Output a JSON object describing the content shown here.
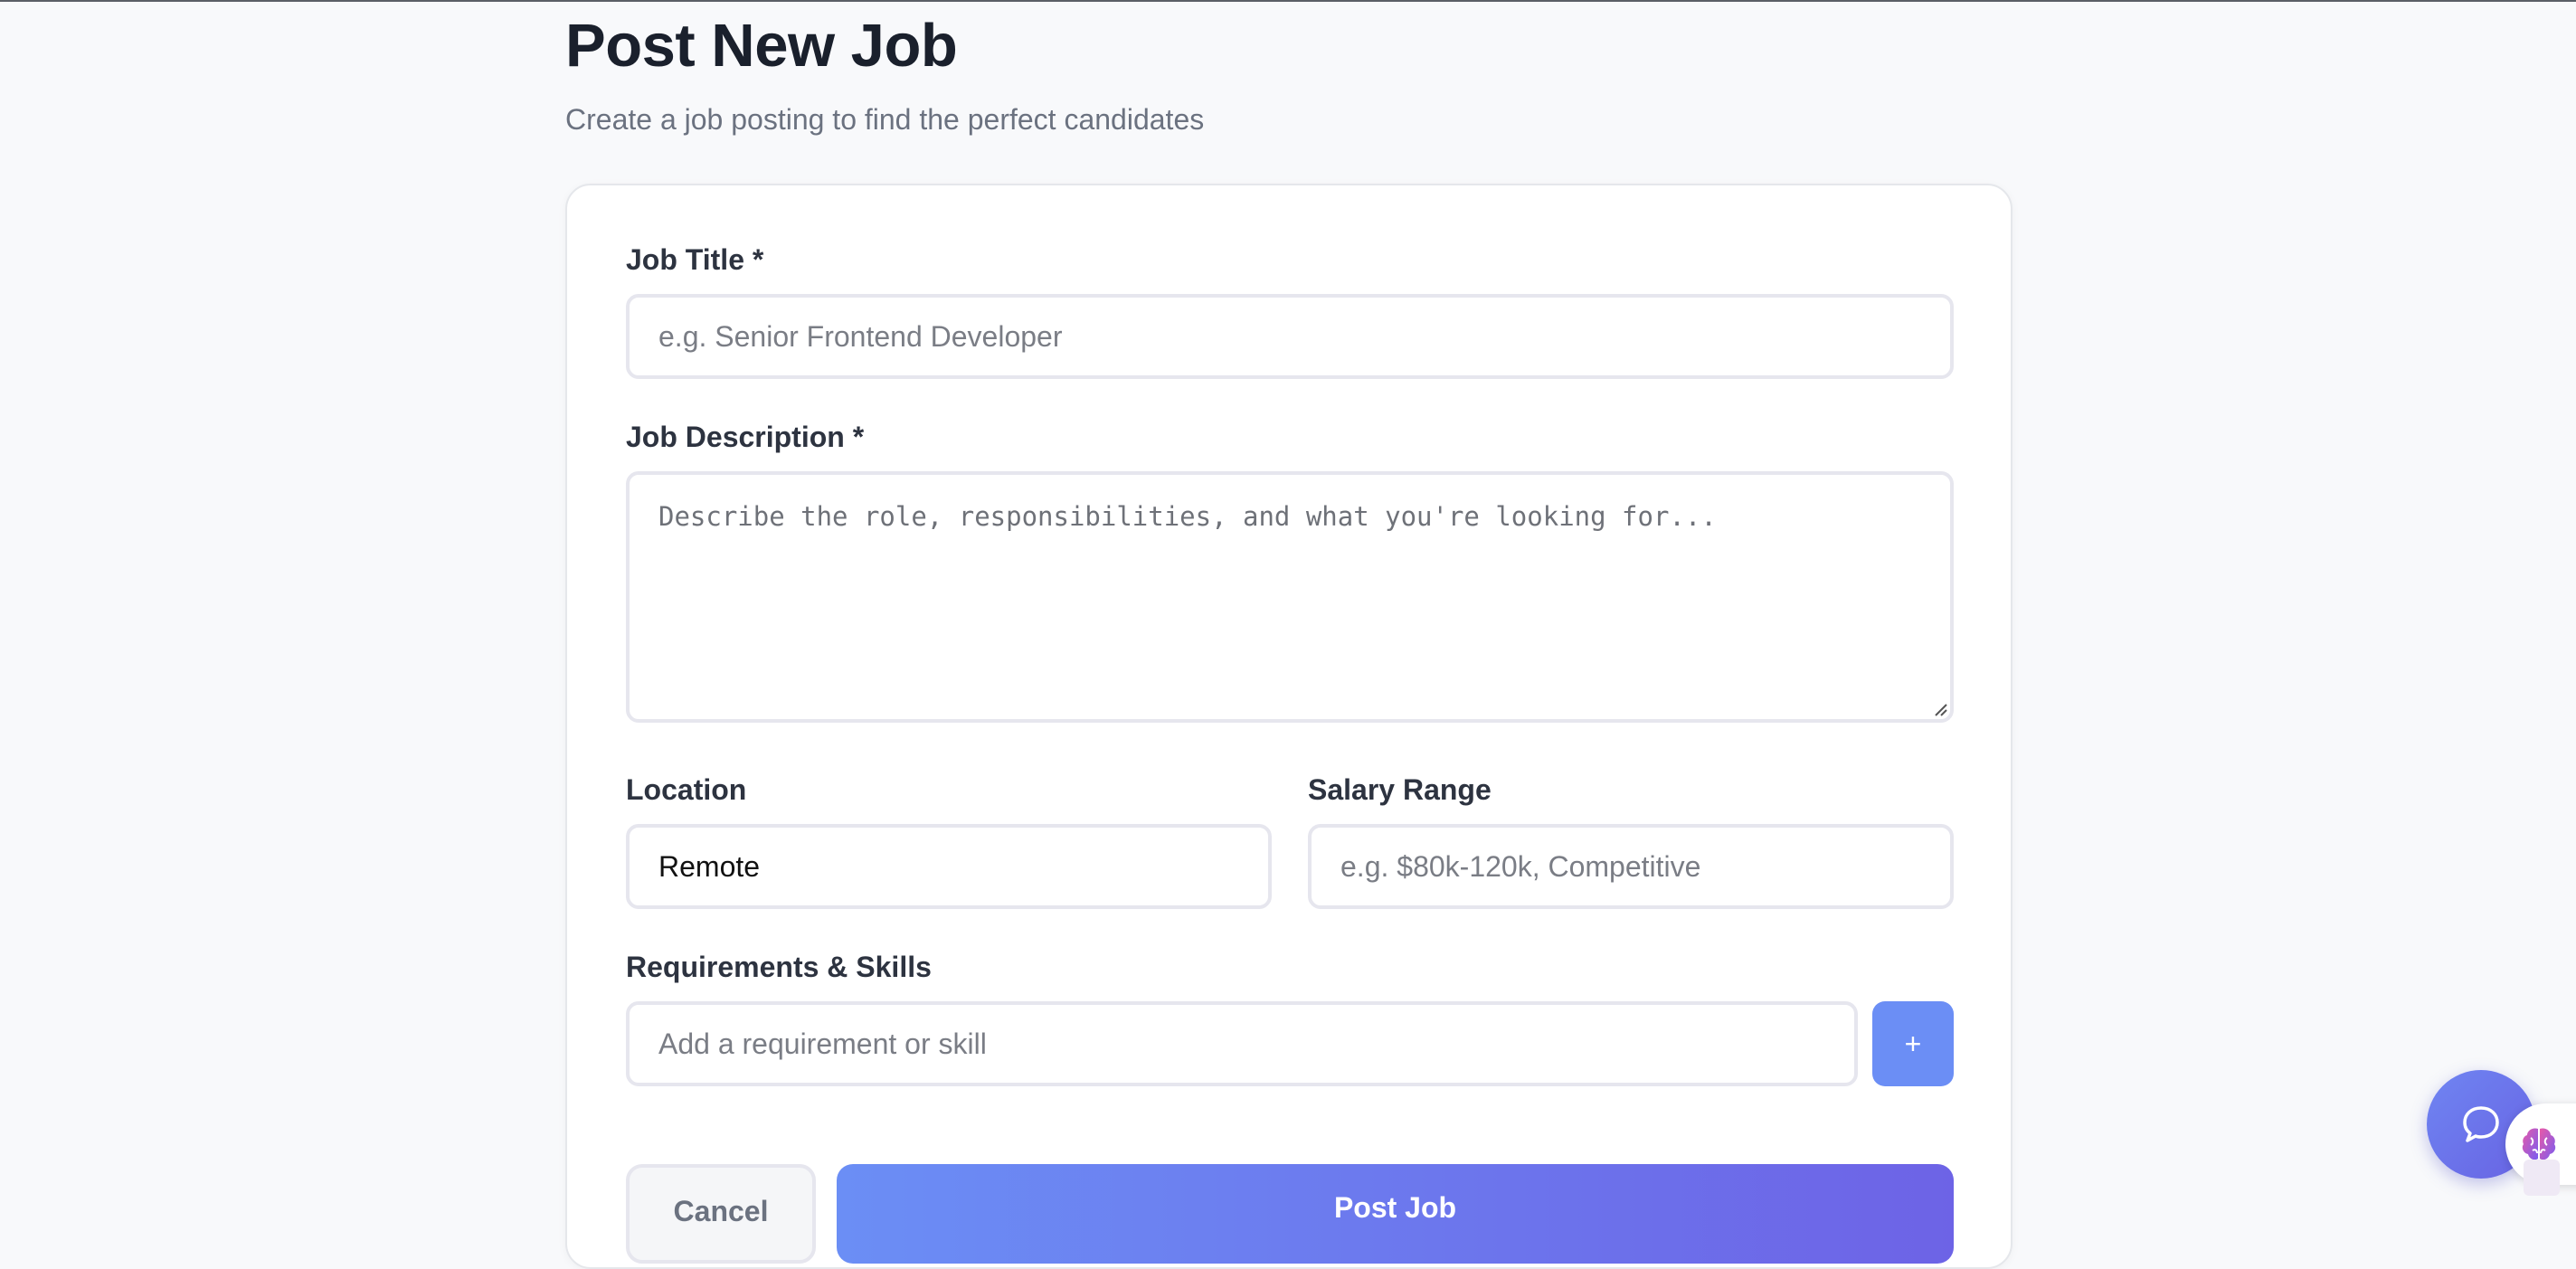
{
  "header": {
    "title": "Post New Job",
    "subtitle": "Create a job posting to find the perfect candidates"
  },
  "form": {
    "job_title": {
      "label": "Job Title *",
      "placeholder": "e.g. Senior Frontend Developer",
      "value": ""
    },
    "job_description": {
      "label": "Job Description *",
      "placeholder": "Describe the role, responsibilities, and what you're looking for...",
      "value": ""
    },
    "location": {
      "label": "Location",
      "value": "Remote"
    },
    "salary_range": {
      "label": "Salary Range",
      "placeholder": "e.g. $80k-120k, Competitive",
      "value": ""
    },
    "requirements": {
      "label": "Requirements & Skills",
      "placeholder": "Add a requirement or skill",
      "add_label": "+"
    },
    "actions": {
      "cancel_label": "Cancel",
      "submit_label": "Post Job"
    }
  },
  "widgets": {
    "chat_icon": "chat-bubble-icon",
    "brain_icon": "brain-icon"
  },
  "colors": {
    "accent": "#6b8ef5",
    "accent_end": "#6d63e6",
    "text_primary": "#1a202c",
    "text_muted": "#6b7280",
    "border": "#e6e6ee"
  }
}
